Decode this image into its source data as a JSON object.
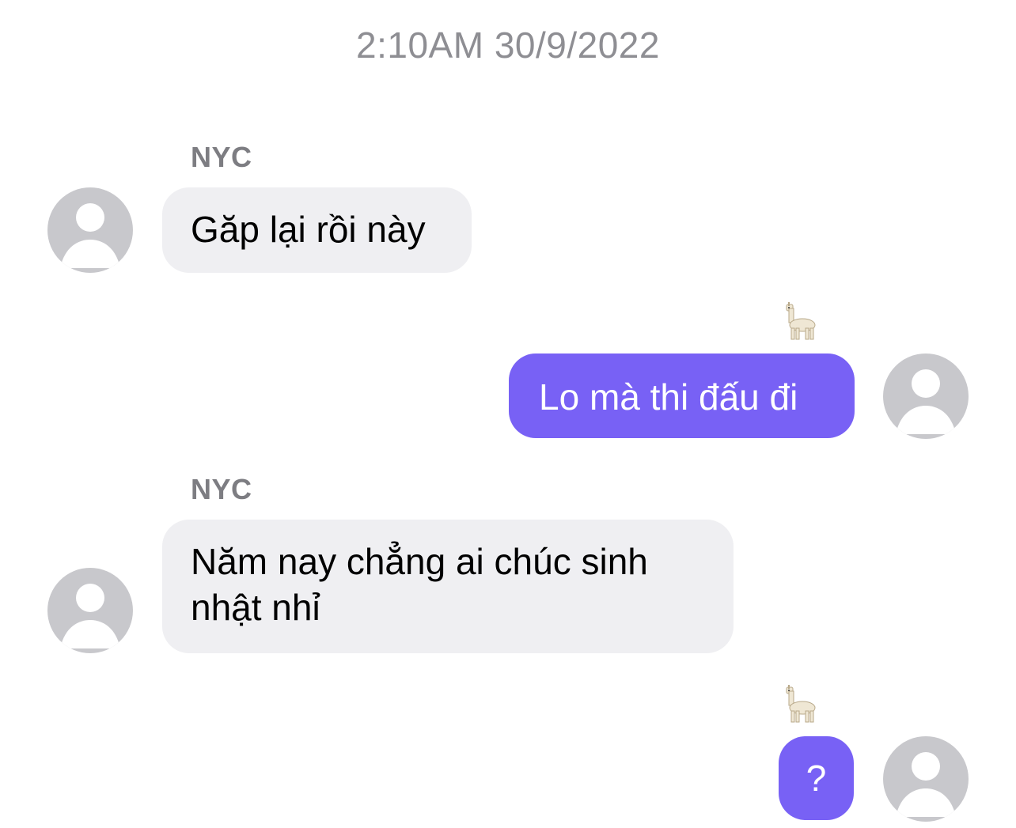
{
  "timestamp": "2:10AM 30/9/2022",
  "colors": {
    "sent_bubble": "#7861f5",
    "received_bubble": "#efeff2",
    "avatar": "#c8c8cc",
    "meta_text": "#8e8e93"
  },
  "messages": [
    {
      "direction": "received",
      "sender": "NYC",
      "text": "Găp lại rồi này",
      "avatar": "default-user-avatar"
    },
    {
      "direction": "sent",
      "text": "Lo mà thi đấu đi",
      "reaction": "llama-emoji",
      "avatar": "default-user-avatar"
    },
    {
      "direction": "received",
      "sender": "NYC",
      "text": "Năm nay chẳng ai chúc sinh nhật nhỉ",
      "avatar": "default-user-avatar"
    },
    {
      "direction": "sent",
      "text": "?",
      "reaction": "llama-emoji",
      "avatar": "default-user-avatar"
    }
  ]
}
